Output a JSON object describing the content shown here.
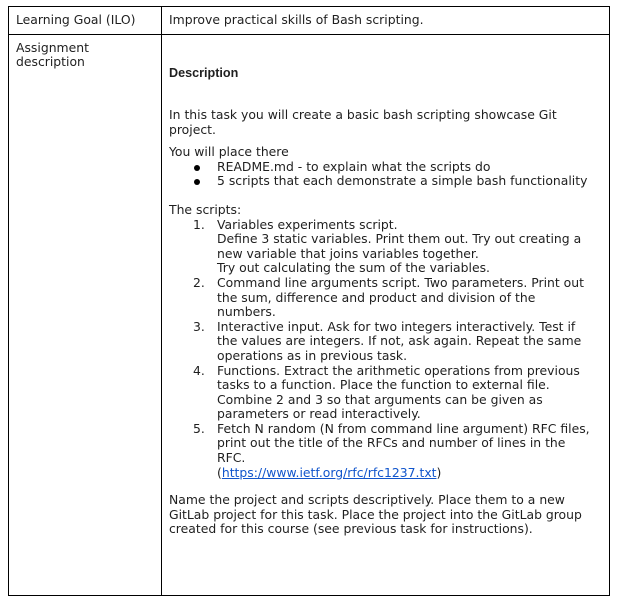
{
  "table": {
    "row1": {
      "label": "Learning Goal (ILO)",
      "value": "Improve practical skills of Bash scripting."
    },
    "row2": {
      "label_line1": "Assignment",
      "label_line2": "description",
      "heading": "Description",
      "intro": "In this task you will create a basic bash scripting showcase Git project.",
      "place_there": "You will place there",
      "bullets": [
        "README.md - to explain what the scripts do",
        "5 scripts that each demonstrate a simple bash functionality"
      ],
      "scripts_heading": "The scripts:",
      "steps": [
        {
          "num": "1.",
          "text": "Variables experiments script.\nDefine 3 static variables. Print them out. Try out creating a new variable that joins variables together.\n Try out calculating the sum of the variables."
        },
        {
          "num": "2.",
          "text": "Command line arguments script. Two parameters. Print out the sum, difference and product and division of the numbers."
        },
        {
          "num": "3.",
          "text": "Interactive input. Ask for two integers interactively. Test if the values are integers. If not, ask again. Repeat the same operations as in previous task."
        },
        {
          "num": "4.",
          "text": "Functions. Extract the arithmetic operations from previous tasks to a function. Place the function to external file. Combine 2 and 3 so that arguments can be given as parameters or read interactively."
        },
        {
          "num": "5.",
          "text": "Fetch N random (N from command line argument)  RFC files, print out the title of the RFCs and number of lines in the RFC.",
          "link_prefix": "(",
          "link_text": "https://www.ietf.org/rfc/rfc1237.txt",
          "link_suffix": ")"
        }
      ],
      "closing": "Name the project and scripts descriptively. Place them to a new GitLab project for this task. Place the project into the GitLab group created for this course (see previous task for instructions)."
    }
  }
}
